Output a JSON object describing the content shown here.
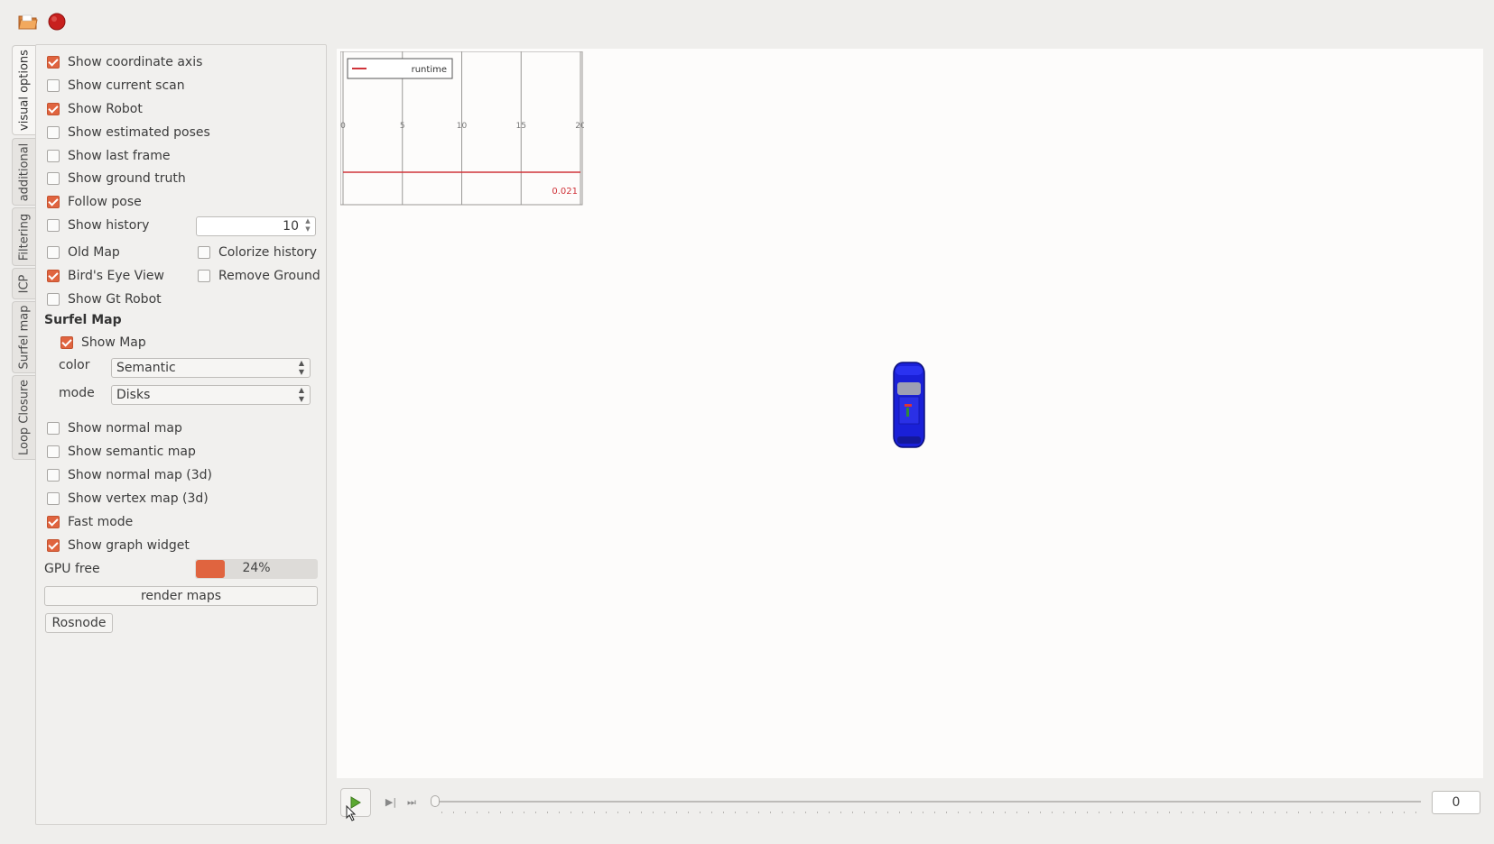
{
  "tabs": [
    {
      "label": "visual options",
      "active": true
    },
    {
      "label": "additional",
      "active": false
    },
    {
      "label": "Filtering",
      "active": false
    },
    {
      "label": "ICP",
      "active": false
    },
    {
      "label": "Surfel map",
      "active": false
    },
    {
      "label": "Loop Closure",
      "active": false
    }
  ],
  "options": {
    "show_coordinate_axis": {
      "label": "Show coordinate axis",
      "checked": true
    },
    "show_current_scan": {
      "label": "Show current scan",
      "checked": false
    },
    "show_robot": {
      "label": "Show Robot",
      "checked": true
    },
    "show_estimated_poses": {
      "label": "Show estimated poses",
      "checked": false
    },
    "show_last_frame": {
      "label": "Show last frame",
      "checked": false
    },
    "show_ground_truth": {
      "label": "Show ground truth",
      "checked": false
    },
    "follow_pose": {
      "label": "Follow pose",
      "checked": true
    },
    "show_history": {
      "label": "Show history",
      "checked": false,
      "value": "10"
    },
    "old_map": {
      "label": "Old Map",
      "checked": false
    },
    "colorize_history": {
      "label": "Colorize history",
      "checked": false
    },
    "birds_eye_view": {
      "label": "Bird's Eye View",
      "checked": true
    },
    "remove_ground": {
      "label": "Remove Ground",
      "checked": false
    },
    "show_gt_robot": {
      "label": "Show Gt Robot",
      "checked": false
    }
  },
  "surfel_map": {
    "title": "Surfel Map",
    "show_map": {
      "label": "Show Map",
      "checked": true
    },
    "color_label": "color",
    "color_value": "Semantic",
    "mode_label": "mode",
    "mode_value": "Disks"
  },
  "more_options": {
    "show_normal_map": {
      "label": "Show normal map",
      "checked": false
    },
    "show_semantic_map": {
      "label": "Show semantic map",
      "checked": false
    },
    "show_normal_map_3d": {
      "label": "Show normal map (3d)",
      "checked": false
    },
    "show_vertex_map_3d": {
      "label": "Show vertex map (3d)",
      "checked": false
    },
    "fast_mode": {
      "label": "Fast mode",
      "checked": true
    },
    "show_graph_widget": {
      "label": "Show graph widget",
      "checked": true
    }
  },
  "gpu": {
    "label": "GPU free",
    "percent": 24,
    "text": "24%"
  },
  "buttons": {
    "render_maps": "render maps",
    "rosnode": "Rosnode"
  },
  "graph": {
    "legend": "runtime",
    "x_ticks": [
      "0",
      "5",
      "10",
      "15",
      "20"
    ],
    "value_label": "0.021",
    "line_color": "#d0343a"
  },
  "playback": {
    "frame": "0"
  },
  "colors": {
    "accent": "#e0643f",
    "car": "#1a20d8"
  },
  "icons": {
    "open": "folder-icon",
    "record": "record-icon",
    "play": "play-icon"
  }
}
